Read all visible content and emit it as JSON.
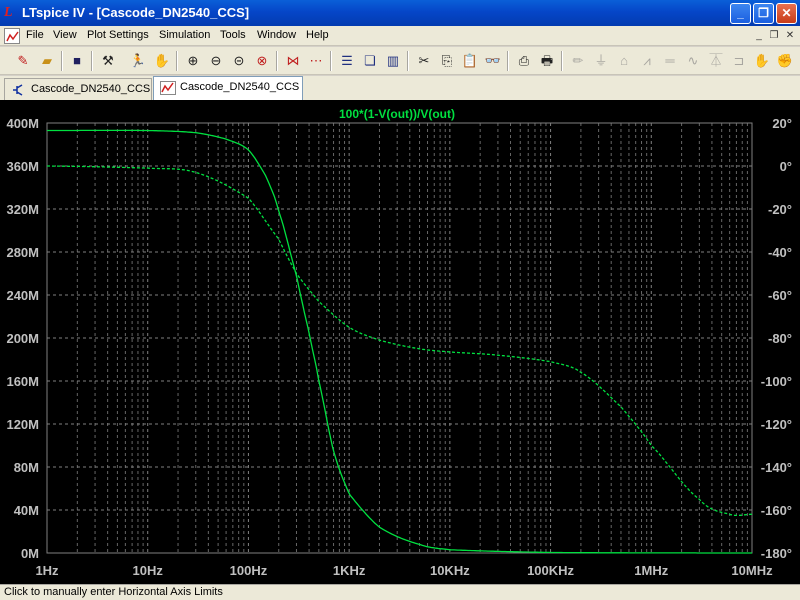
{
  "window": {
    "title": "LTspice IV - [Cascode_DN2540_CCS]",
    "minimize_glyph": "_",
    "restore_glyph": "❐",
    "close_glyph": "✕"
  },
  "menu": {
    "items": [
      "File",
      "View",
      "Plot Settings",
      "Simulation",
      "Tools",
      "Window",
      "Help"
    ],
    "mdi_minimize": "_",
    "mdi_restore": "❐",
    "mdi_close": "✕"
  },
  "toolbar": {
    "icons": [
      "new-schematic-icon",
      "open-icon",
      "save-icon",
      "control-panel-icon",
      "run-icon",
      "halt-icon",
      "zoom-in-icon",
      "zoom-out-icon",
      "zoom-fit-icon",
      "cancel-zoom-icon",
      "autorange-icon",
      "manual-limits-icon",
      "tile-horizontal-icon",
      "cascade-icon",
      "tile-vertical-icon",
      "cut-icon",
      "copy-icon",
      "paste-icon",
      "find-icon",
      "print-preview-icon",
      "print-icon",
      "wire-icon",
      "ground-icon",
      "label-icon",
      "resistor-icon",
      "capacitor-icon",
      "inductor-icon",
      "diode-icon",
      "component-icon",
      "move-icon"
    ]
  },
  "tabs": [
    {
      "label": "Cascode_DN2540_CCS",
      "icon": "schematic-icon",
      "active": false
    },
    {
      "label": "Cascode_DN2540_CCS",
      "icon": "waveform-icon",
      "active": true
    }
  ],
  "plot": {
    "trace_label": "100*(1-V(out))/V(out)",
    "trace_color": "#00e040",
    "grid_color": "#808080",
    "axis_text_color": "#c0c0c0"
  },
  "chart_data": {
    "type": "line",
    "title": "100*(1-V(out))/V(out)",
    "x_scale": "log",
    "xlim": [
      1,
      10000000
    ],
    "x_ticks": [
      "1Hz",
      "10Hz",
      "100Hz",
      "1KHz",
      "10KHz",
      "100KHz",
      "1MHz",
      "10MHz"
    ],
    "y_left_ticks": [
      "0M",
      "40M",
      "80M",
      "120M",
      "160M",
      "200M",
      "240M",
      "280M",
      "320M",
      "360M",
      "400M"
    ],
    "y_left_lim": [
      0,
      400
    ],
    "y_left_unit": "M",
    "y_right_ticks": [
      "-180°",
      "-160°",
      "-140°",
      "-120°",
      "-100°",
      "-80°",
      "-60°",
      "-40°",
      "-20°",
      "0°",
      "20°"
    ],
    "y_right_lim": [
      -180,
      20
    ],
    "grid": true,
    "series": [
      {
        "axis": "left",
        "style": "solid",
        "x": [
          1,
          10,
          30,
          60,
          100,
          150,
          200,
          300,
          400,
          500,
          700,
          1000,
          2000,
          5000,
          10000,
          100000,
          10000000
        ],
        "y": [
          393,
          393,
          391,
          385,
          375,
          350,
          318,
          258,
          205,
          160,
          95,
          55,
          24,
          8,
          3,
          0.5,
          0
        ]
      },
      {
        "axis": "right",
        "style": "dashed",
        "x": [
          1,
          10,
          30,
          100,
          200,
          300,
          500,
          1000,
          2000,
          5000,
          10000,
          30000,
          100000,
          200000,
          500000,
          1000000,
          3000000,
          6000000,
          10000000
        ],
        "y": [
          0,
          -1,
          -3,
          -15,
          -34,
          -50,
          -63,
          -75,
          -81,
          -85,
          -86.5,
          -88,
          -91,
          -96,
          -112,
          -130,
          -155,
          -162,
          -162
        ]
      }
    ]
  },
  "statusbar": {
    "text": "Click to manually enter Horizontal Axis Limits"
  }
}
